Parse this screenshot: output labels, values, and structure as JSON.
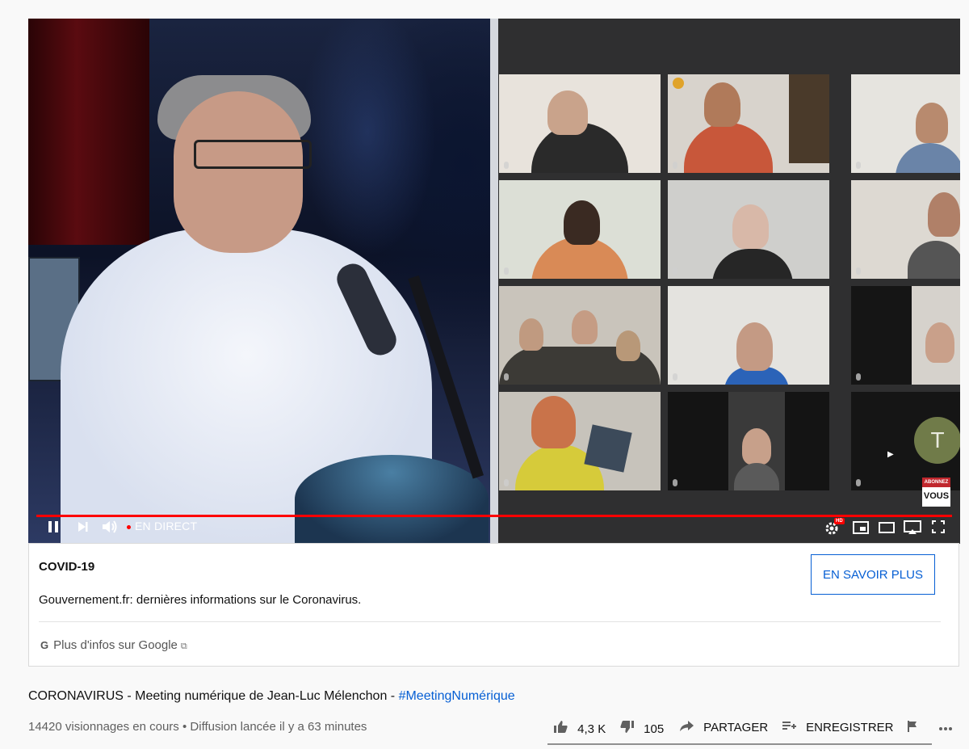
{
  "player": {
    "live_label": "EN DIRECT",
    "progress_color": "#ff0000",
    "overlay": {
      "line1": "ABONNEZ",
      "line2": "VOUS"
    },
    "participant_avatar_letter": "T",
    "controls": {
      "pause_icon": "pause-icon",
      "next_icon": "next-icon",
      "volume_icon": "volume-icon",
      "settings_icon": "gear-icon",
      "settings_badge": "HD",
      "miniplayer_icon": "miniplayer-icon",
      "theater_icon": "theater-icon",
      "cast_icon": "cast-icon",
      "fullscreen_icon": "fullscreen-icon"
    }
  },
  "ad_panel": {
    "title": "COVID-19",
    "description": "Gouvernement.fr: dernières informations sur le Coronavirus.",
    "button_label": "EN SAVOIR PLUS",
    "footer_label": "Plus d'infos sur Google",
    "google_glyph": "G",
    "accent_color": "#065fd4"
  },
  "video": {
    "title": "CORONAVIRUS - Meeting numérique de Jean-Luc Mélenchon - ",
    "hashtag": "#MeetingNumérique",
    "views": "14420 visionnages en cours",
    "separator": "•",
    "started": "Diffusion lancée il y a 63 minutes"
  },
  "actions": {
    "likes": "4,3 K",
    "dislikes": "105",
    "share": "PARTAGER",
    "save": "ENREGISTRER"
  }
}
